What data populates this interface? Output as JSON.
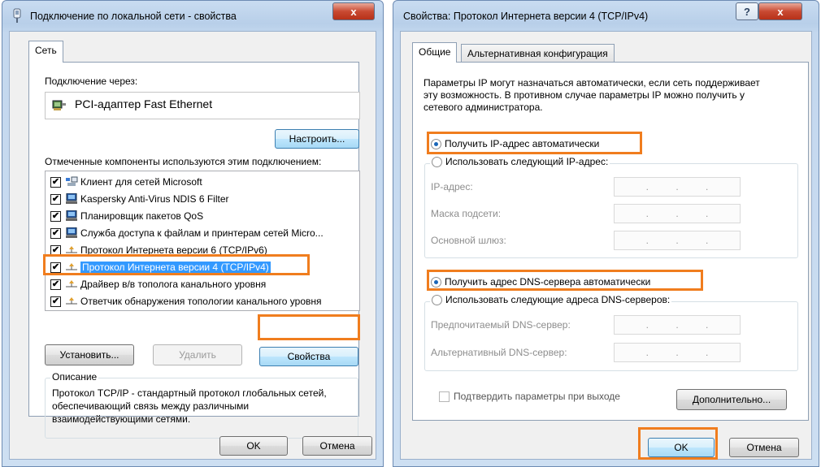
{
  "left_window": {
    "title": "Подключение по локальной сети - свойства",
    "close_glyph": "x",
    "tab_label": "Сеть",
    "connect_via_label": "Подключение через:",
    "adapter_name": "PCI-адаптер Fast Ethernet",
    "configure_button": "Настроить...",
    "components_label": "Отмеченные компоненты используются этим подключением:",
    "components": [
      {
        "label": "Клиент для сетей Microsoft",
        "checked": true,
        "icon": "network-client-icon"
      },
      {
        "label": "Kaspersky Anti-Virus NDIS 6 Filter",
        "checked": true,
        "icon": "computer-icon"
      },
      {
        "label": "Планировщик пакетов QoS",
        "checked": true,
        "icon": "computer-icon"
      },
      {
        "label": "Служба доступа к файлам и принтерам сетей Micro...",
        "checked": true,
        "icon": "computer-icon"
      },
      {
        "label": "Протокол Интернета версии 6 (TCP/IPv6)",
        "checked": true,
        "icon": "protocol-icon"
      },
      {
        "label": "Протокол Интернета версии 4 (TCP/IPv4)",
        "checked": true,
        "icon": "protocol-icon",
        "selected": true
      },
      {
        "label": "Драйвер в/в тополога канального уровня",
        "checked": true,
        "icon": "protocol-icon"
      },
      {
        "label": "Ответчик обнаружения топологии канального уровня",
        "checked": true,
        "icon": "protocol-icon"
      }
    ],
    "install_button": "Установить...",
    "remove_button": "Удалить",
    "properties_button": "Свойства",
    "description_label": "Описание",
    "description_text": "Протокол TCP/IP - стандартный протокол глобальных сетей, обеспечивающий связь между различными взаимодействующими сетями.",
    "ok_button": "OK",
    "cancel_button": "Отмена"
  },
  "right_window": {
    "title": "Свойства: Протокол Интернета версии 4 (TCP/IPv4)",
    "help_glyph": "?",
    "close_glyph": "x",
    "tabs": [
      "Общие",
      "Альтернативная конфигурация"
    ],
    "intro_text": "Параметры IP могут назначаться автоматически, если сеть поддерживает эту возможность. В противном случае параметры IP можно получить у сетевого администратора.",
    "ip_auto_radio": "Получить IP-адрес автоматически",
    "ip_manual_radio": "Использовать следующий IP-адрес:",
    "ip_address_label": "IP-адрес:",
    "subnet_mask_label": "Маска подсети:",
    "gateway_label": "Основной шлюз:",
    "dns_auto_radio": "Получить адрес DNS-сервера автоматически",
    "dns_manual_radio": "Использовать следующие адреса DNS-серверов:",
    "preferred_dns_label": "Предпочитаемый DNS-сервер:",
    "alternate_dns_label": "Альтернативный DNS-сервер:",
    "ip_dot": ".",
    "validate_checkbox": "Подтвердить параметры при выходе",
    "advanced_button": "Дополнительно...",
    "ok_button": "OK",
    "cancel_button": "Отмена"
  },
  "highlight_color": "#f07d1e"
}
